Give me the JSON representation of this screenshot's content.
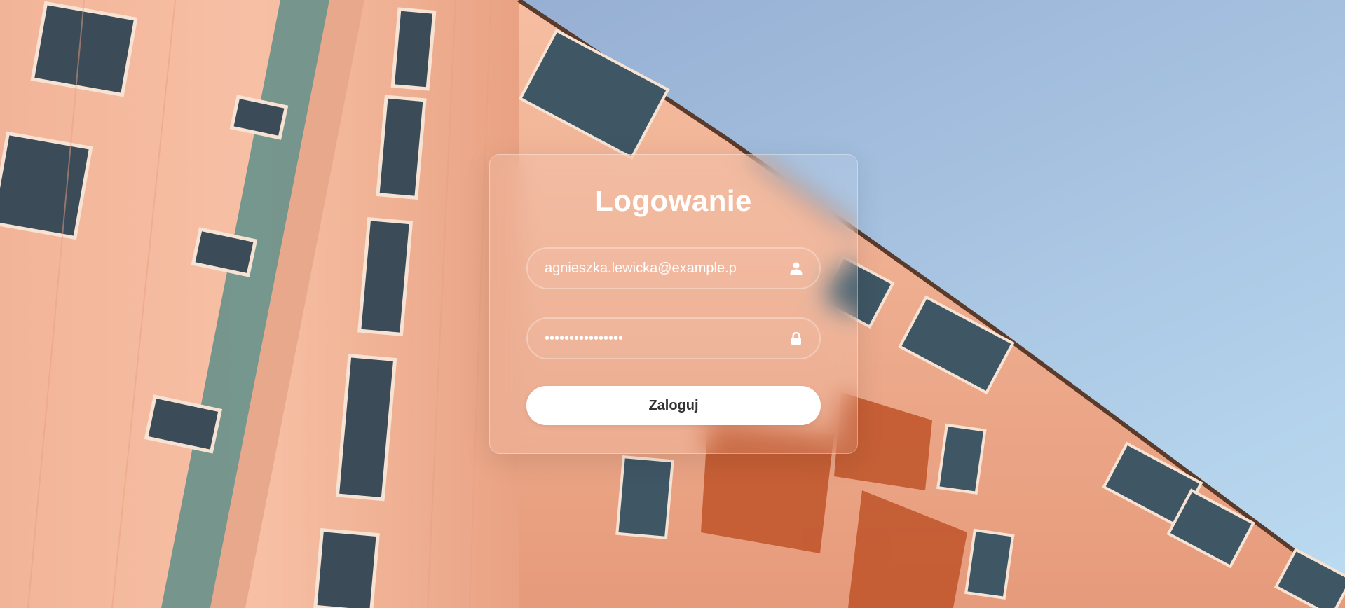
{
  "login": {
    "title": "Logowanie",
    "email_value": "agnieszka.lewicka@example.p",
    "email_icon": "user-icon",
    "password_value": "••••••••••••••••",
    "password_icon": "lock-icon",
    "submit_label": "Zaloguj"
  },
  "colors": {
    "button_bg": "#ffffff",
    "button_text": "#333333",
    "text_white": "#ffffff",
    "sky": "#9cb8d8",
    "facade": "#f4b89a"
  }
}
